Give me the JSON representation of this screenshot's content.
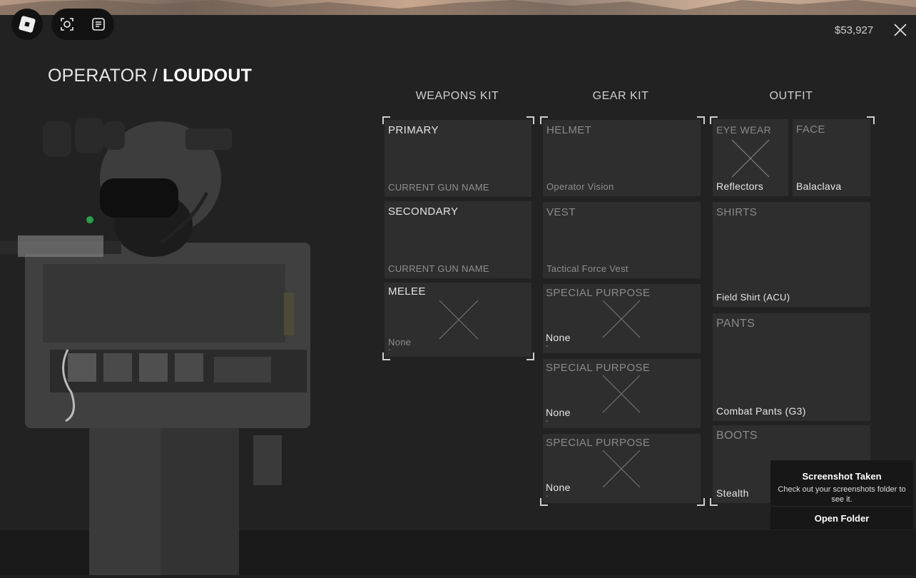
{
  "topbar": {
    "menu_icon": "roblox-logo-icon",
    "selfie_icon": "camera-frame-icon",
    "chat_icon": "chat-icon"
  },
  "header": {
    "balance": "$53,927",
    "close_icon": "close-icon"
  },
  "title": {
    "prefix": "OPERATOR /",
    "main": "LOUDOUT"
  },
  "columns": {
    "weapons": "WEAPONS KIT",
    "gear": "GEAR KIT",
    "outfit": "OUTFIT"
  },
  "weapons": {
    "primary": {
      "label": "PRIMARY",
      "item": "CURRENT GUN NAME"
    },
    "secondary": {
      "label": "SECONDARY",
      "item": "CURRENT GUN NAME"
    },
    "melee": {
      "label": "MELEE",
      "item": "None",
      "dash": "-"
    }
  },
  "gear": {
    "helmet": {
      "label": "HELMET",
      "item": "Operator Vision"
    },
    "vest": {
      "label": "VEST",
      "item": "Tactical Force Vest"
    },
    "special": [
      {
        "label": "SPECIAL PURPOSE",
        "item": "None",
        "dash": "-"
      },
      {
        "label": "SPECIAL PURPOSE",
        "item": "None",
        "dash": "-"
      },
      {
        "label": "SPECIAL PURPOSE",
        "item": "None",
        "dash": "-"
      }
    ]
  },
  "outfit": {
    "eyewear": {
      "label": "EYE WEAR",
      "item": "Reflectors"
    },
    "face": {
      "label": "FACE",
      "item": "Balaclava"
    },
    "shirts": {
      "label": "SHIRTS",
      "item": "Field Shirt (ACU)"
    },
    "pants": {
      "label": "PANTS",
      "item": "Combat Pants (G3)"
    },
    "boots": {
      "label": "BOOTS",
      "item": "Stealth"
    }
  },
  "toast": {
    "title": "Screenshot Taken",
    "message": "Check out your screenshots folder to see it.",
    "button": "Open Folder"
  }
}
